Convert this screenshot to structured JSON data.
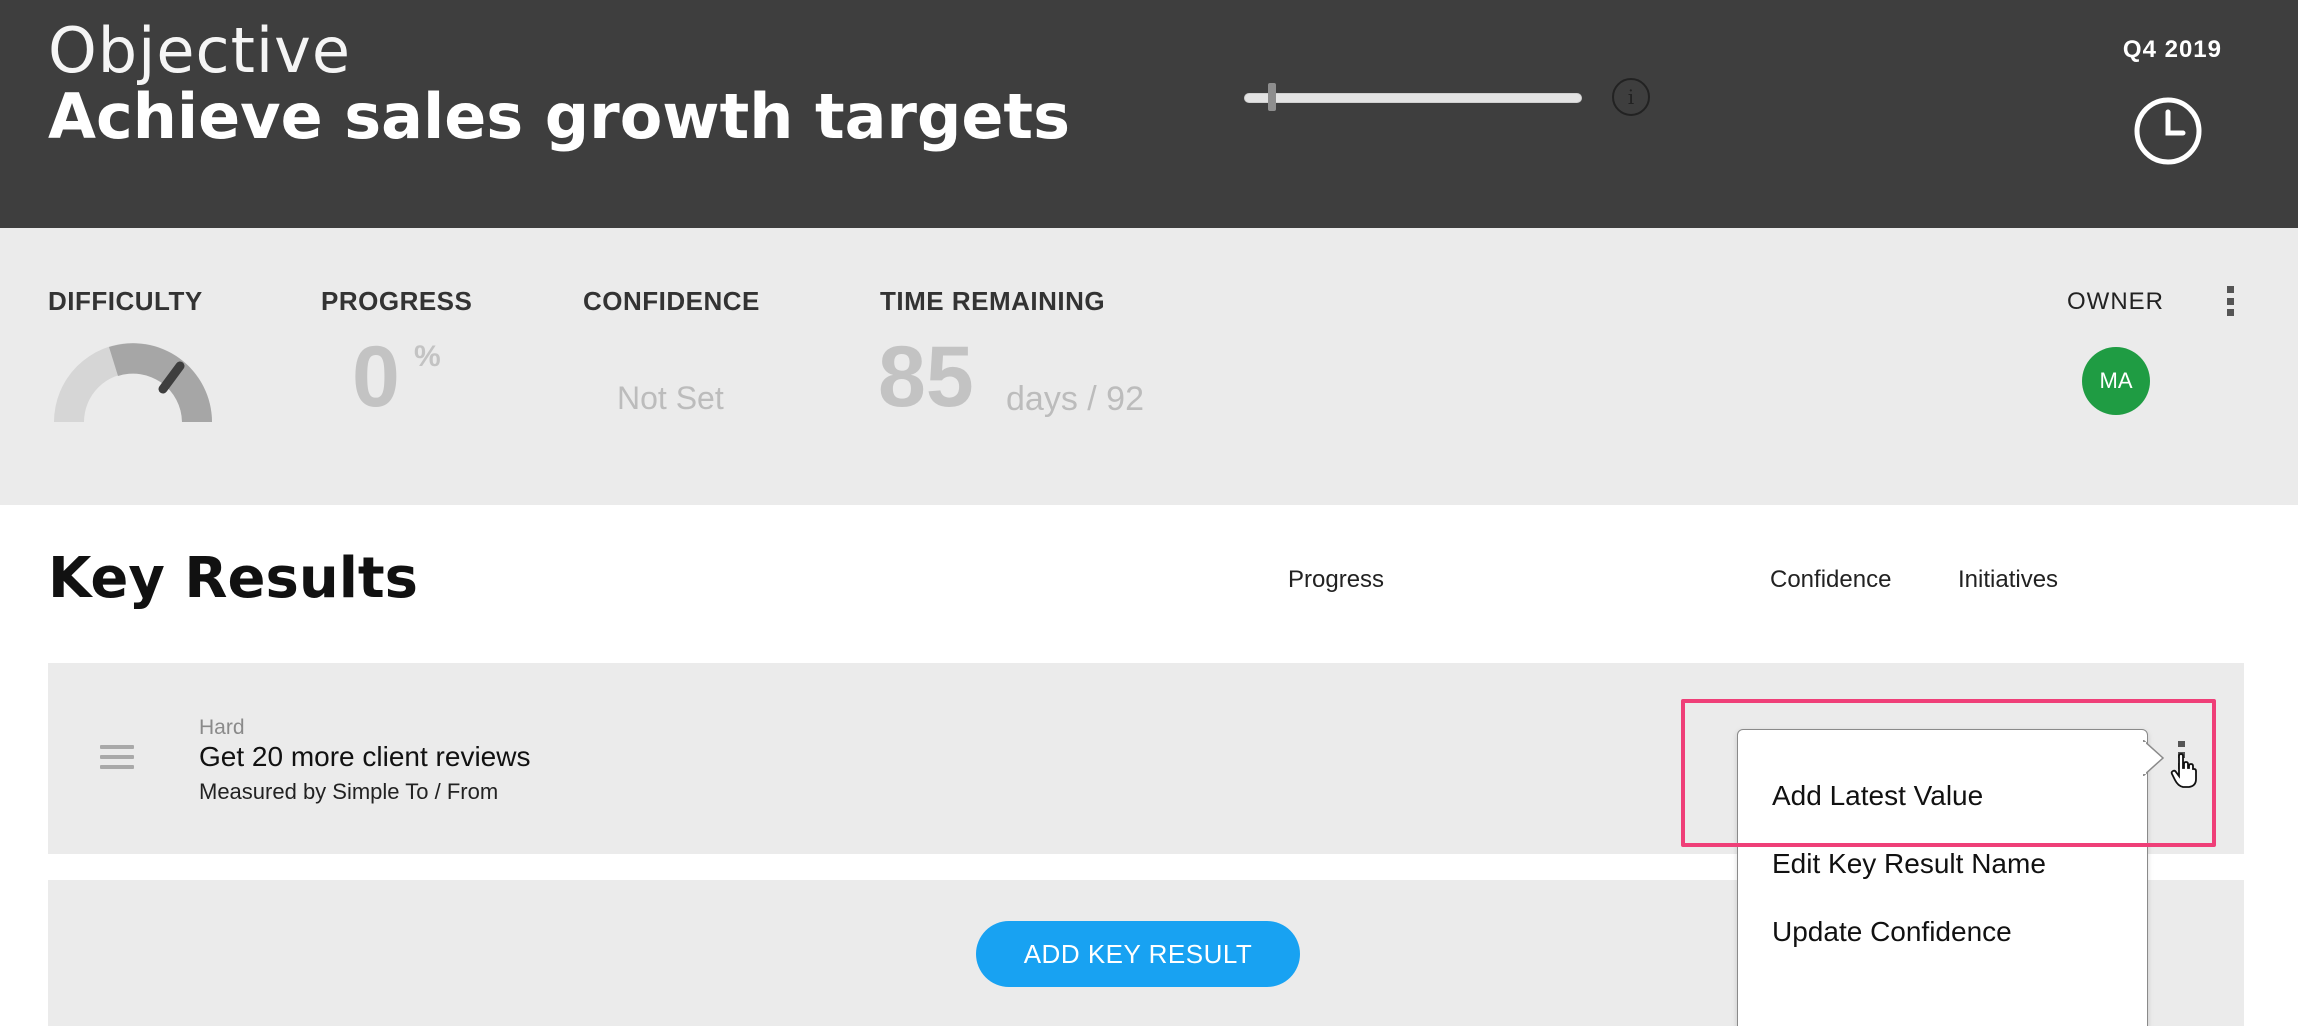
{
  "header": {
    "objective_label": "Objective",
    "objective_title": "Achieve sales growth targets",
    "quarter": "Q4 2019"
  },
  "stats": {
    "difficulty_label": "DIFFICULTY",
    "progress_label": "PROGRESS",
    "progress_value": "0",
    "progress_unit": "%",
    "confidence_label": "CONFIDENCE",
    "confidence_value": "Not Set",
    "time_label": "TIME REMAINING",
    "days_remaining": "85",
    "days_total_text": "days / 92",
    "owner_label": "OWNER",
    "owner_initials": "MA",
    "owner_color": "#1f9c43"
  },
  "key_results": {
    "title": "Key Results",
    "columns": {
      "progress": "Progress",
      "confidence": "Confidence",
      "initiatives": "Initiatives"
    },
    "items": [
      {
        "difficulty": "Hard",
        "name": "Get 20 more client reviews",
        "measure": "Measured by Simple To / From",
        "progress_fraction": 0.0
      }
    ],
    "add_button": "ADD KEY RESULT"
  },
  "menu": {
    "items": [
      {
        "label": "Add Latest Value"
      },
      {
        "label": "Edit Key Result Name"
      },
      {
        "label": "Update Confidence"
      }
    ]
  },
  "icons": {
    "clock": "clock-icon",
    "info": "info-icon",
    "drag": "drag-handle-icon",
    "more": "more-vertical-icon",
    "cursor": "hand-pointer-icon"
  },
  "colors": {
    "header_bg": "#3e3e3e",
    "stats_bg": "#ebebeb",
    "accent_blue": "#18a2f2",
    "highlight": "#ef3f78"
  }
}
